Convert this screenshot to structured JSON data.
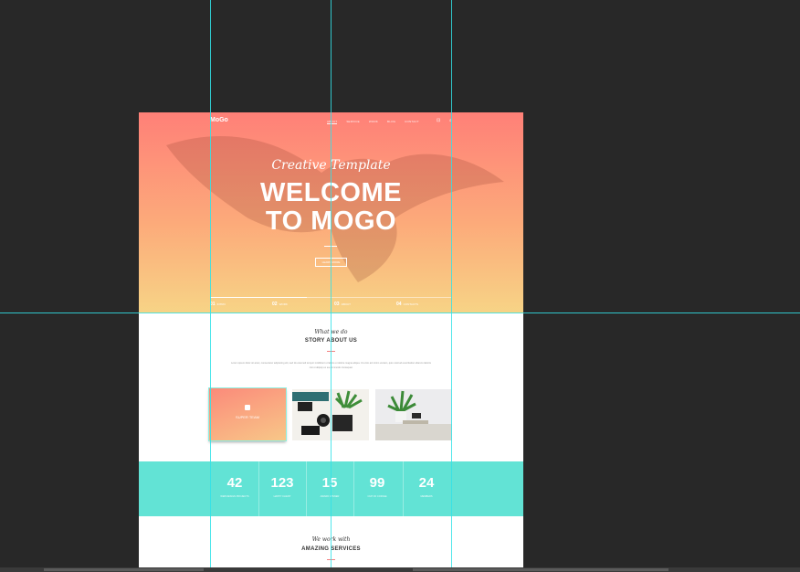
{
  "canvas": {
    "nav": {
      "logo": "MoGo",
      "links": [
        "ABOUT",
        "SERVICE",
        "WORK",
        "BLOG",
        "CONTACT"
      ]
    },
    "hero": {
      "subtitle": "Creative Template",
      "headline_line1": "WELCOME",
      "headline_line2": "TO MOGO",
      "button": "LEARN MORE",
      "stats": [
        {
          "num": "01",
          "label": "INTRO"
        },
        {
          "num": "02",
          "label": "WORK"
        },
        {
          "num": "03",
          "label": "ABOUT"
        },
        {
          "num": "04",
          "label": "CONTACTS"
        }
      ],
      "stats_progress": 0.4
    },
    "about": {
      "script": "What we do",
      "title": "STORY ABOUT US",
      "text": "Lorem ipsum dolor sit amet, consectetur adipiscing elit, sed do eiusmod tempor incididunt ut labore et dolore magna aliqua. Ut enim ad minim veniam, quis nostrud exercitation ullamco laboris nisi ut aliquip ex ea commodo consequat.",
      "card1_label": "SUPER TEAM"
    },
    "counters": [
      {
        "num": "42",
        "label": "WEB DESIGN PROJECTS"
      },
      {
        "num": "123",
        "label": "HAPPY CLIENT"
      },
      {
        "num": "15",
        "label": "AWARD WINNER"
      },
      {
        "num": "99",
        "label": "CUP OF COFFEE"
      },
      {
        "num": "24",
        "label": "MEMBERS"
      }
    ],
    "services": {
      "script": "We work with",
      "title": "AMAZING SERVICES"
    }
  },
  "colors": {
    "hero_top": "#ff8078",
    "hero_bottom": "#f7d486",
    "counter_band": "#62e3d5",
    "guides": "#31e2e8",
    "workspace": "#282828"
  }
}
